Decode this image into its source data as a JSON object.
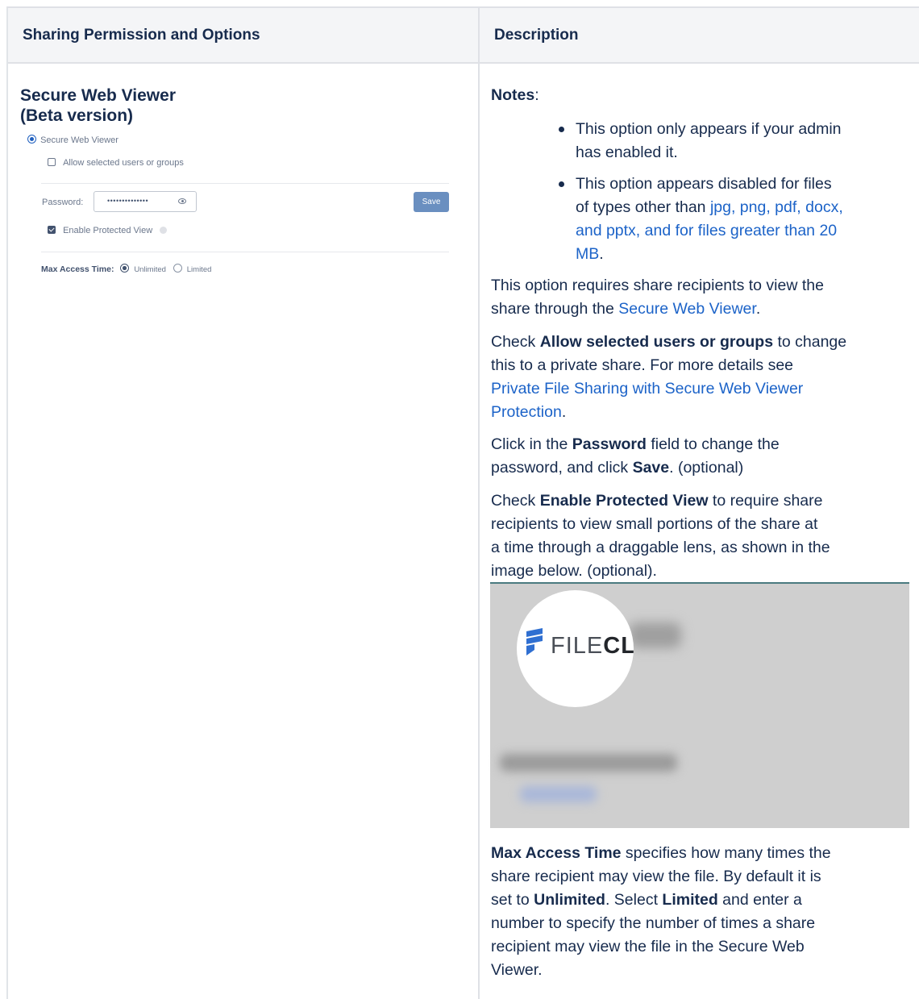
{
  "table": {
    "header": {
      "col1": "Sharing Permission and Options",
      "col2": "Description"
    }
  },
  "left": {
    "title_line1": "Secure Web Viewer",
    "title_line2": "(Beta version)",
    "ui": {
      "radio_label": "Secure Web Viewer",
      "allow_label": "Allow selected users or groups",
      "password_label": "Password:",
      "password_value": "••••••••••••••",
      "save_label": "Save",
      "protected_label": "Enable Protected View",
      "max_access_label": "Max Access Time:",
      "option_unlimited": "Unlimited",
      "option_limited": "Limited"
    }
  },
  "right": {
    "notes_label": "Notes",
    "notes_colon": ":",
    "bullet1_line1": "This option only appears if your admin",
    "bullet1_line2": "has enabled it.",
    "bullet2_line1": "This option appears disabled for files",
    "bullet2_line2_pre": "of types other than ",
    "bullet2_line2_link": "jpg, png, pdf, docx,",
    "bullet2_line3_link": "and pptx, and for files greater than 20",
    "bullet2_line4_link": "MB",
    "bullet2_line4_post": ".",
    "p1_line1": "This option requires share recipients to view the",
    "p1_line2_pre": "share through the ",
    "p1_line2_link": "Secure Web Viewer",
    "p1_line2_post": ".",
    "p2_line1_pre": "Check ",
    "p2_line1_bold": "Allow selected users or groups",
    "p2_line1_post": " to change",
    "p2_line2": "this to a private share. For more details see",
    "p2_line3_link": "Private File Sharing with Secure Web Viewer",
    "p2_line4_link": "Protection",
    "p2_line4_post": ".",
    "p3_line1_pre": "Click in the ",
    "p3_line1_bold": "Password",
    "p3_line1_post": " field to change the",
    "p3_line2_pre": "password, and click ",
    "p3_line2_bold": "Save",
    "p3_line2_post": ". (optional)",
    "p4_line1_pre": "Check ",
    "p4_line1_bold": "Enable Protected View",
    "p4_line1_post": " to require share",
    "p4_line2": "recipients to view small portions of the share at",
    "p4_line3": "a time through a draggable lens, as shown in the",
    "p4_line4": "image below. (optional).",
    "image_logo_plain": "FILE",
    "image_logo_bold": "CL",
    "p5_line1_bold": "Max Access Time",
    "p5_line1_post": " specifies how many times the",
    "p5_line2": "share recipient may view the file. By default it is",
    "p5_line3_pre": "set to ",
    "p5_line3_bold1": "Unlimited",
    "p5_line3_mid": ". Select ",
    "p5_line3_bold2": "Limited",
    "p5_line3_post": " and enter a",
    "p5_line4": "number to specify the number of times a share",
    "p5_line5": "recipient may view the file in the Secure Web",
    "p5_line6": "Viewer."
  },
  "colors": {
    "link": "#1c63c8",
    "text": "#172b4d",
    "save_button": "#6a8fc0",
    "header_bg": "#f4f5f7"
  }
}
